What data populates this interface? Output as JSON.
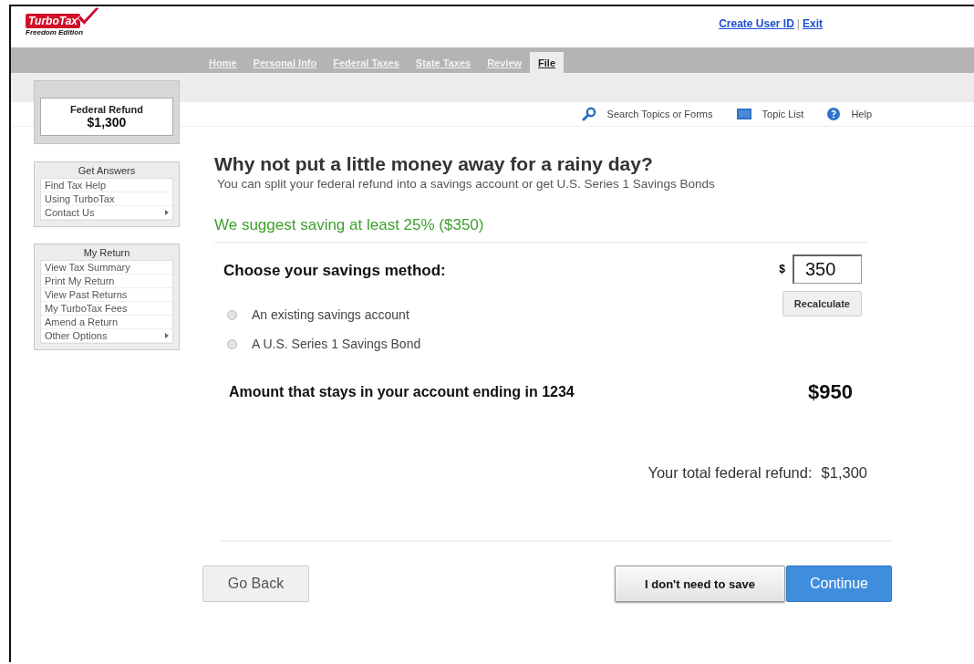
{
  "header": {
    "logo": {
      "brand": "TurboTax",
      "edition": "Freedom Edition"
    },
    "links": [
      "Create User ID",
      "Exit"
    ],
    "link_separator": "|"
  },
  "nav_tabs": [
    {
      "label": "Home",
      "selected": false
    },
    {
      "label": "Personal Info",
      "selected": false
    },
    {
      "label": "Federal Taxes",
      "selected": false
    },
    {
      "label": "State Taxes",
      "selected": false
    },
    {
      "label": "Review",
      "selected": false
    },
    {
      "label": "File",
      "selected": true
    }
  ],
  "refund": {
    "label": "Federal Refund",
    "amount": "$1,300"
  },
  "toolbar": [
    {
      "kind": "search",
      "label": "Search Topics or Forms"
    },
    {
      "kind": "list",
      "label": "Topic List"
    },
    {
      "kind": "help",
      "label": "Help"
    }
  ],
  "sidebar": [
    {
      "title": "Get Answers",
      "items": [
        {
          "label": "Find Tax Help",
          "submenu": false
        },
        {
          "label": "Using TurboTax",
          "submenu": false
        },
        {
          "label": "Contact Us",
          "submenu": true
        }
      ]
    },
    {
      "title": "My Return",
      "items": [
        {
          "label": "View Tax Summary",
          "submenu": false
        },
        {
          "label": "Print My Return",
          "submenu": false
        },
        {
          "label": "View Past Returns",
          "submenu": false
        },
        {
          "label": "My TurboTax Fees",
          "submenu": false
        },
        {
          "label": "Amend a Return",
          "submenu": false
        },
        {
          "label": "Other Options",
          "submenu": true
        }
      ]
    }
  ],
  "main": {
    "heading": "Why not put a little money away for a rainy day?",
    "subheading": "You can split your federal refund into a savings account or get U.S. Series 1 Savings Bonds",
    "suggestion": "We suggest saving at least 25% ($350)",
    "method_label": "Choose your savings method:",
    "currency": "$",
    "amount_value": "350",
    "recalculate": "Recalculate",
    "methods": [
      {
        "label": "An existing savings account",
        "selected": false
      },
      {
        "label": "A U.S. Series 1 Savings Bond",
        "selected": false
      }
    ],
    "remaining_label": "Amount that stays in your  account ending in 1234",
    "remaining_amount": "$950",
    "total_label": "Your total federal refund:",
    "total_amount": "$1,300"
  },
  "buttons": [
    {
      "kind": "back",
      "label": "Go Back"
    },
    {
      "kind": "secondary",
      "label": "I don't need to save"
    },
    {
      "kind": "primary",
      "label": "Continue"
    }
  ]
}
